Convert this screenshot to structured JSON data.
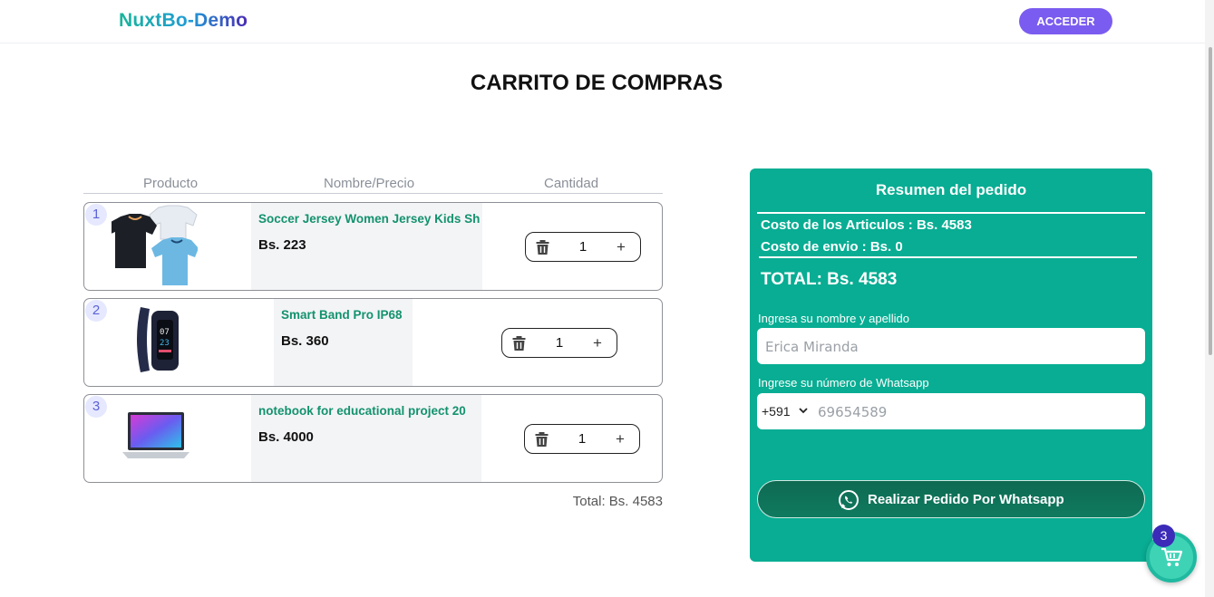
{
  "header": {
    "brand": "NuxtBo-Demo",
    "login_label": "ACCEDER"
  },
  "page": {
    "title": "CARRITO DE COMPRAS"
  },
  "cart": {
    "columns": [
      "Producto",
      "Nombre/Precio",
      "Cantidad"
    ],
    "items": [
      {
        "index": "1",
        "name": "Soccer Jersey Women Jersey Kids Sh",
        "price": "Bs. 223",
        "quantity": "1",
        "image": "jersey-image"
      },
      {
        "index": "2",
        "name": "Smart Band Pro IP68",
        "price": "Bs. 360",
        "quantity": "1",
        "image": "smartband-image"
      },
      {
        "index": "3",
        "name": "notebook for educational project 20",
        "price": "Bs. 4000",
        "quantity": "1",
        "image": "notebook-image"
      }
    ],
    "total": "Total: Bs. 4583"
  },
  "summary": {
    "title": "Resumen del pedido",
    "items_cost": "Costo de los Articulos : Bs. 4583",
    "shipping_cost": "Costo de envio : Bs. 0",
    "total": "TOTAL: Bs. 4583",
    "name_label": "Ingresa su nombre y apellido",
    "name_placeholder": "Erica Miranda",
    "phone_label": "Ingrese su número de Whatsapp",
    "phone_code": "+591",
    "phone_placeholder": "69654589",
    "whatsapp_button": "Realizar Pedido Por Whatsapp"
  },
  "floating_cart": {
    "count": "3"
  },
  "colors": {
    "accent": "#08ad93",
    "brand_purple": "#7b5cf0",
    "product_name": "#13926e",
    "whatsapp_button": "#0e6a52"
  }
}
